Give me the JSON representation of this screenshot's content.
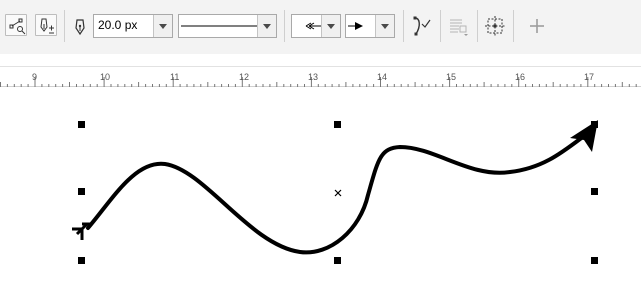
{
  "toolbar": {
    "outline_width": "20.0 px",
    "icons": {
      "shape_tool": "node-shape-icon",
      "outline_pen": "pen-settings-icon",
      "pen_nib": "pen-nib-icon",
      "start_arrowhead": "start-arrowhead-icon",
      "end_arrowhead": "end-arrowhead-icon",
      "line_style": "line-style-icon",
      "curve_smoothing": "curve-smoothing-icon",
      "wrap_text": "wrap-text-icon",
      "show_bounding": "bounding-box-icon",
      "add": "plus-icon"
    }
  },
  "ruler": {
    "labels": [
      "9",
      "10",
      "11",
      "12",
      "13",
      "14",
      "15",
      "16",
      "17"
    ]
  },
  "colors": {
    "toolbar_bg": "#f3f3f3",
    "curve": "#000000",
    "handles": "#000000"
  }
}
